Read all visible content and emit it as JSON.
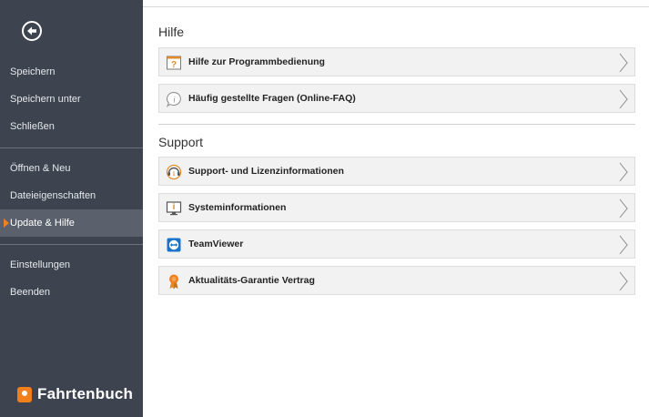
{
  "sidebar": {
    "items": [
      {
        "label": "Speichern",
        "active": false
      },
      {
        "label": "Speichern unter",
        "active": false
      },
      {
        "label": "Schließen",
        "active": false
      },
      {
        "label": "Öffnen & Neu",
        "active": false
      },
      {
        "label": "Dateieigenschaften",
        "active": false
      },
      {
        "label": "Update & Hilfe",
        "active": true
      },
      {
        "label": "Einstellungen",
        "active": false
      },
      {
        "label": "Beenden",
        "active": false
      }
    ],
    "logo_text": "Fahrtenbuch",
    "accent_color": "#f07f1c",
    "background_color": "#3d4450"
  },
  "main": {
    "help_section": {
      "title": "Hilfe",
      "items": [
        {
          "label": "Hilfe zur Programmbedienung",
          "icon": "help-book-icon"
        },
        {
          "label": "Häufig gestellte Fragen (Online-FAQ)",
          "icon": "info-bubble-icon"
        }
      ]
    },
    "support_section": {
      "title": "Support",
      "items": [
        {
          "label": "Support- und Lizenzinformationen",
          "icon": "headset-icon"
        },
        {
          "label": "Systeminformationen",
          "icon": "monitor-icon"
        },
        {
          "label": "TeamViewer",
          "icon": "teamviewer-icon"
        },
        {
          "label": "Aktualitäts-Garantie Vertrag",
          "icon": "award-icon"
        }
      ]
    }
  }
}
